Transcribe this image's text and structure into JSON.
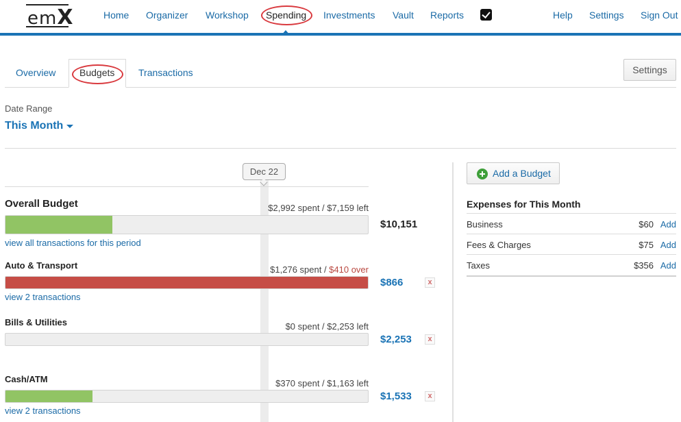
{
  "brand": {
    "logo_text_a": "em",
    "logo_text_b": "X"
  },
  "nav": {
    "items": [
      {
        "label": "Home"
      },
      {
        "label": "Organizer"
      },
      {
        "label": "Workshop"
      },
      {
        "label": "Spending"
      },
      {
        "label": "Investments"
      },
      {
        "label": "Vault"
      },
      {
        "label": "Reports"
      }
    ],
    "right": [
      {
        "label": "Help"
      },
      {
        "label": "Settings"
      },
      {
        "label": "Sign Out"
      }
    ]
  },
  "subtabs": [
    {
      "label": "Overview"
    },
    {
      "label": "Budgets"
    },
    {
      "label": "Transactions"
    }
  ],
  "settings_button": "Settings",
  "date_range": {
    "label": "Date Range",
    "value": "This Month"
  },
  "timeline": {
    "marker": "Dec 22"
  },
  "budgets": [
    {
      "name": "Overall Budget",
      "spent_text": "$2,992 spent / $7,159 left",
      "over_text": "",
      "amount": "$10,151",
      "fill": 0.295,
      "link": "view all transactions for this period"
    },
    {
      "name": "Auto & Transport",
      "spent_text": "$1,276 spent / ",
      "over_text": "$410 over",
      "amount": "$866",
      "fill": 1.0,
      "link": "view 2 transactions",
      "remove": "x"
    },
    {
      "name": "Bills & Utilities",
      "spent_text": "$0 spent / $2,253 left",
      "over_text": "",
      "amount": "$2,253",
      "fill": 0.0,
      "link": "",
      "remove": "x"
    },
    {
      "name": "Cash/ATM",
      "spent_text": "$370 spent / $1,163 left",
      "over_text": "",
      "amount": "$1,533",
      "fill": 0.241,
      "link": "view 2 transactions",
      "remove": "x"
    }
  ],
  "right_panel": {
    "add_button": "Add a Budget",
    "expenses_title": "Expenses for This Month",
    "expenses": [
      {
        "name": "Business",
        "amount": "$60",
        "action": "Add"
      },
      {
        "name": "Fees & Charges",
        "amount": "$75",
        "action": "Add"
      },
      {
        "name": "Taxes",
        "amount": "$356",
        "action": "Add"
      }
    ]
  },
  "colors": {
    "accent": "#1a73b5",
    "progress": "#91c464",
    "over_budget": "#c64d46",
    "highlight_ring": "#d9393e"
  }
}
